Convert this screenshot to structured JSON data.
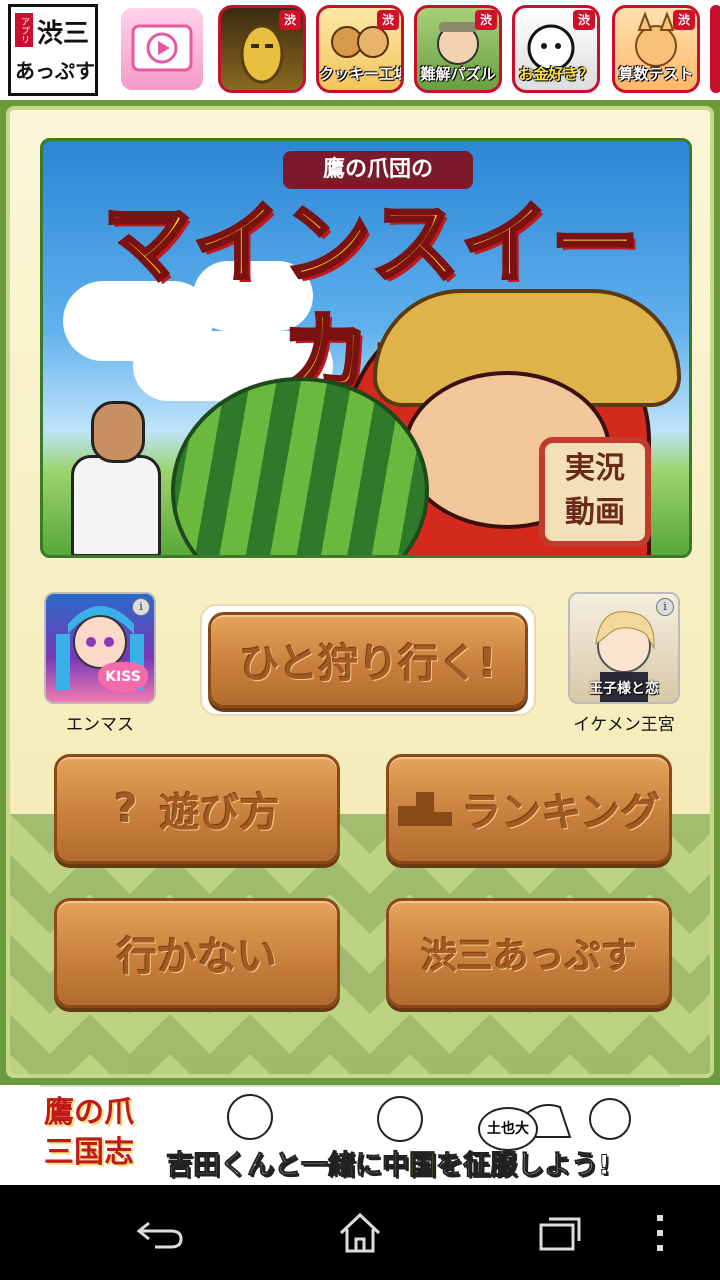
{
  "top_strip": {
    "logo": {
      "label_line1": "渋三",
      "label_line2": "あっぷす",
      "side_tag": "アプリ"
    },
    "apps": [
      {
        "name": "video-app",
        "label": "",
        "badge": ""
      },
      {
        "name": "golden-robot",
        "label": "",
        "badge": "渋"
      },
      {
        "name": "cookie-factory",
        "label": "クッキー工場",
        "badge": "渋"
      },
      {
        "name": "difficult-puzzle",
        "label": "難解パズル",
        "badge": "渋"
      },
      {
        "name": "money-cat",
        "label": "お金好き？",
        "badge": "渋"
      },
      {
        "name": "math-test",
        "label": "算数テスト",
        "badge": "渋"
      }
    ]
  },
  "banner": {
    "subtitle": "鷹の爪団の",
    "title": "マインスイーカー",
    "video_badge": [
      "実況",
      "動画"
    ]
  },
  "ads": [
    {
      "label": "エンマス",
      "overlay": "KISS",
      "info": "i"
    },
    {
      "label": "イケメン王宮",
      "overlay": "王子様と恋",
      "info": "i"
    }
  ],
  "buttons": {
    "hunt": "ひと狩り行く!",
    "how_to_play": "遊び方",
    "ranking": "ランキング",
    "dont_go": "行かない",
    "shibu_apps": "渋三あっぷす"
  },
  "ad_banner": {
    "logo_line1": "鷹の爪",
    "logo_line2": "三国志",
    "copy_pre": "吉田くんと一緒に",
    "copy_highlight": "中国",
    "copy_post": "を征服しよう!",
    "bubble": "土也大"
  },
  "colors": {
    "panel_green": "#6a9a3c",
    "wood": "#c9803e",
    "title_yellow": "#ffd21a",
    "badge_red": "#d0102a"
  }
}
